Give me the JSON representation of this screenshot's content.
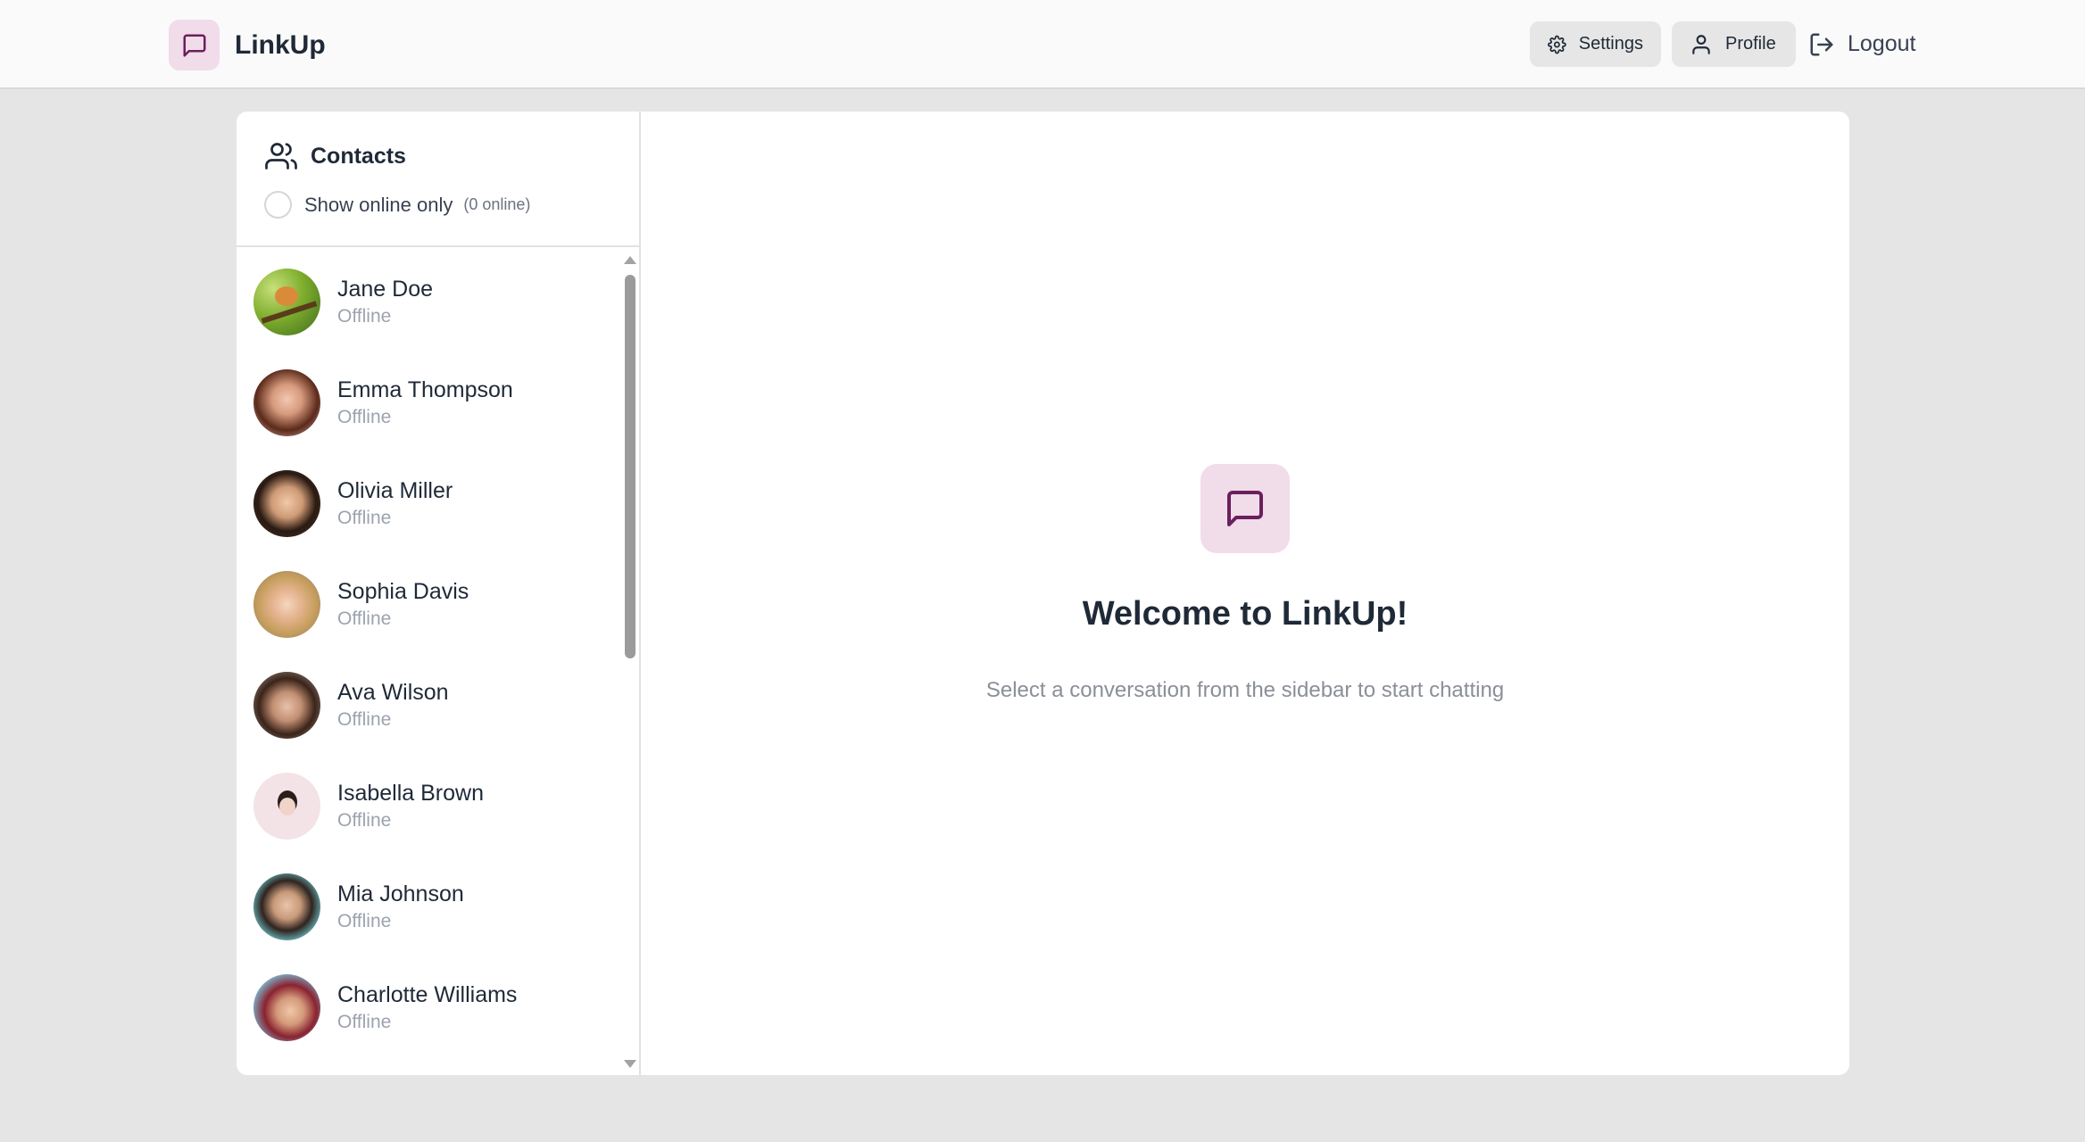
{
  "app": {
    "name": "LinkUp",
    "accent": "#6b1f5c",
    "accent_bg": "#f1dcea"
  },
  "nav": {
    "settings_label": "Settings",
    "profile_label": "Profile",
    "logout_label": "Logout"
  },
  "sidebar": {
    "title": "Contacts",
    "online_toggle_label": "Show online only",
    "online_count": "(0 online)",
    "contacts": [
      {
        "name": "Jane Doe",
        "status": "Offline"
      },
      {
        "name": "Emma Thompson",
        "status": "Offline"
      },
      {
        "name": "Olivia Miller",
        "status": "Offline"
      },
      {
        "name": "Sophia Davis",
        "status": "Offline"
      },
      {
        "name": "Ava Wilson",
        "status": "Offline"
      },
      {
        "name": "Isabella Brown",
        "status": "Offline"
      },
      {
        "name": "Mia Johnson",
        "status": "Offline"
      },
      {
        "name": "Charlotte Williams",
        "status": "Offline"
      }
    ]
  },
  "welcome": {
    "title": "Welcome to LinkUp!",
    "subtitle": "Select a conversation from the sidebar to start chatting"
  }
}
